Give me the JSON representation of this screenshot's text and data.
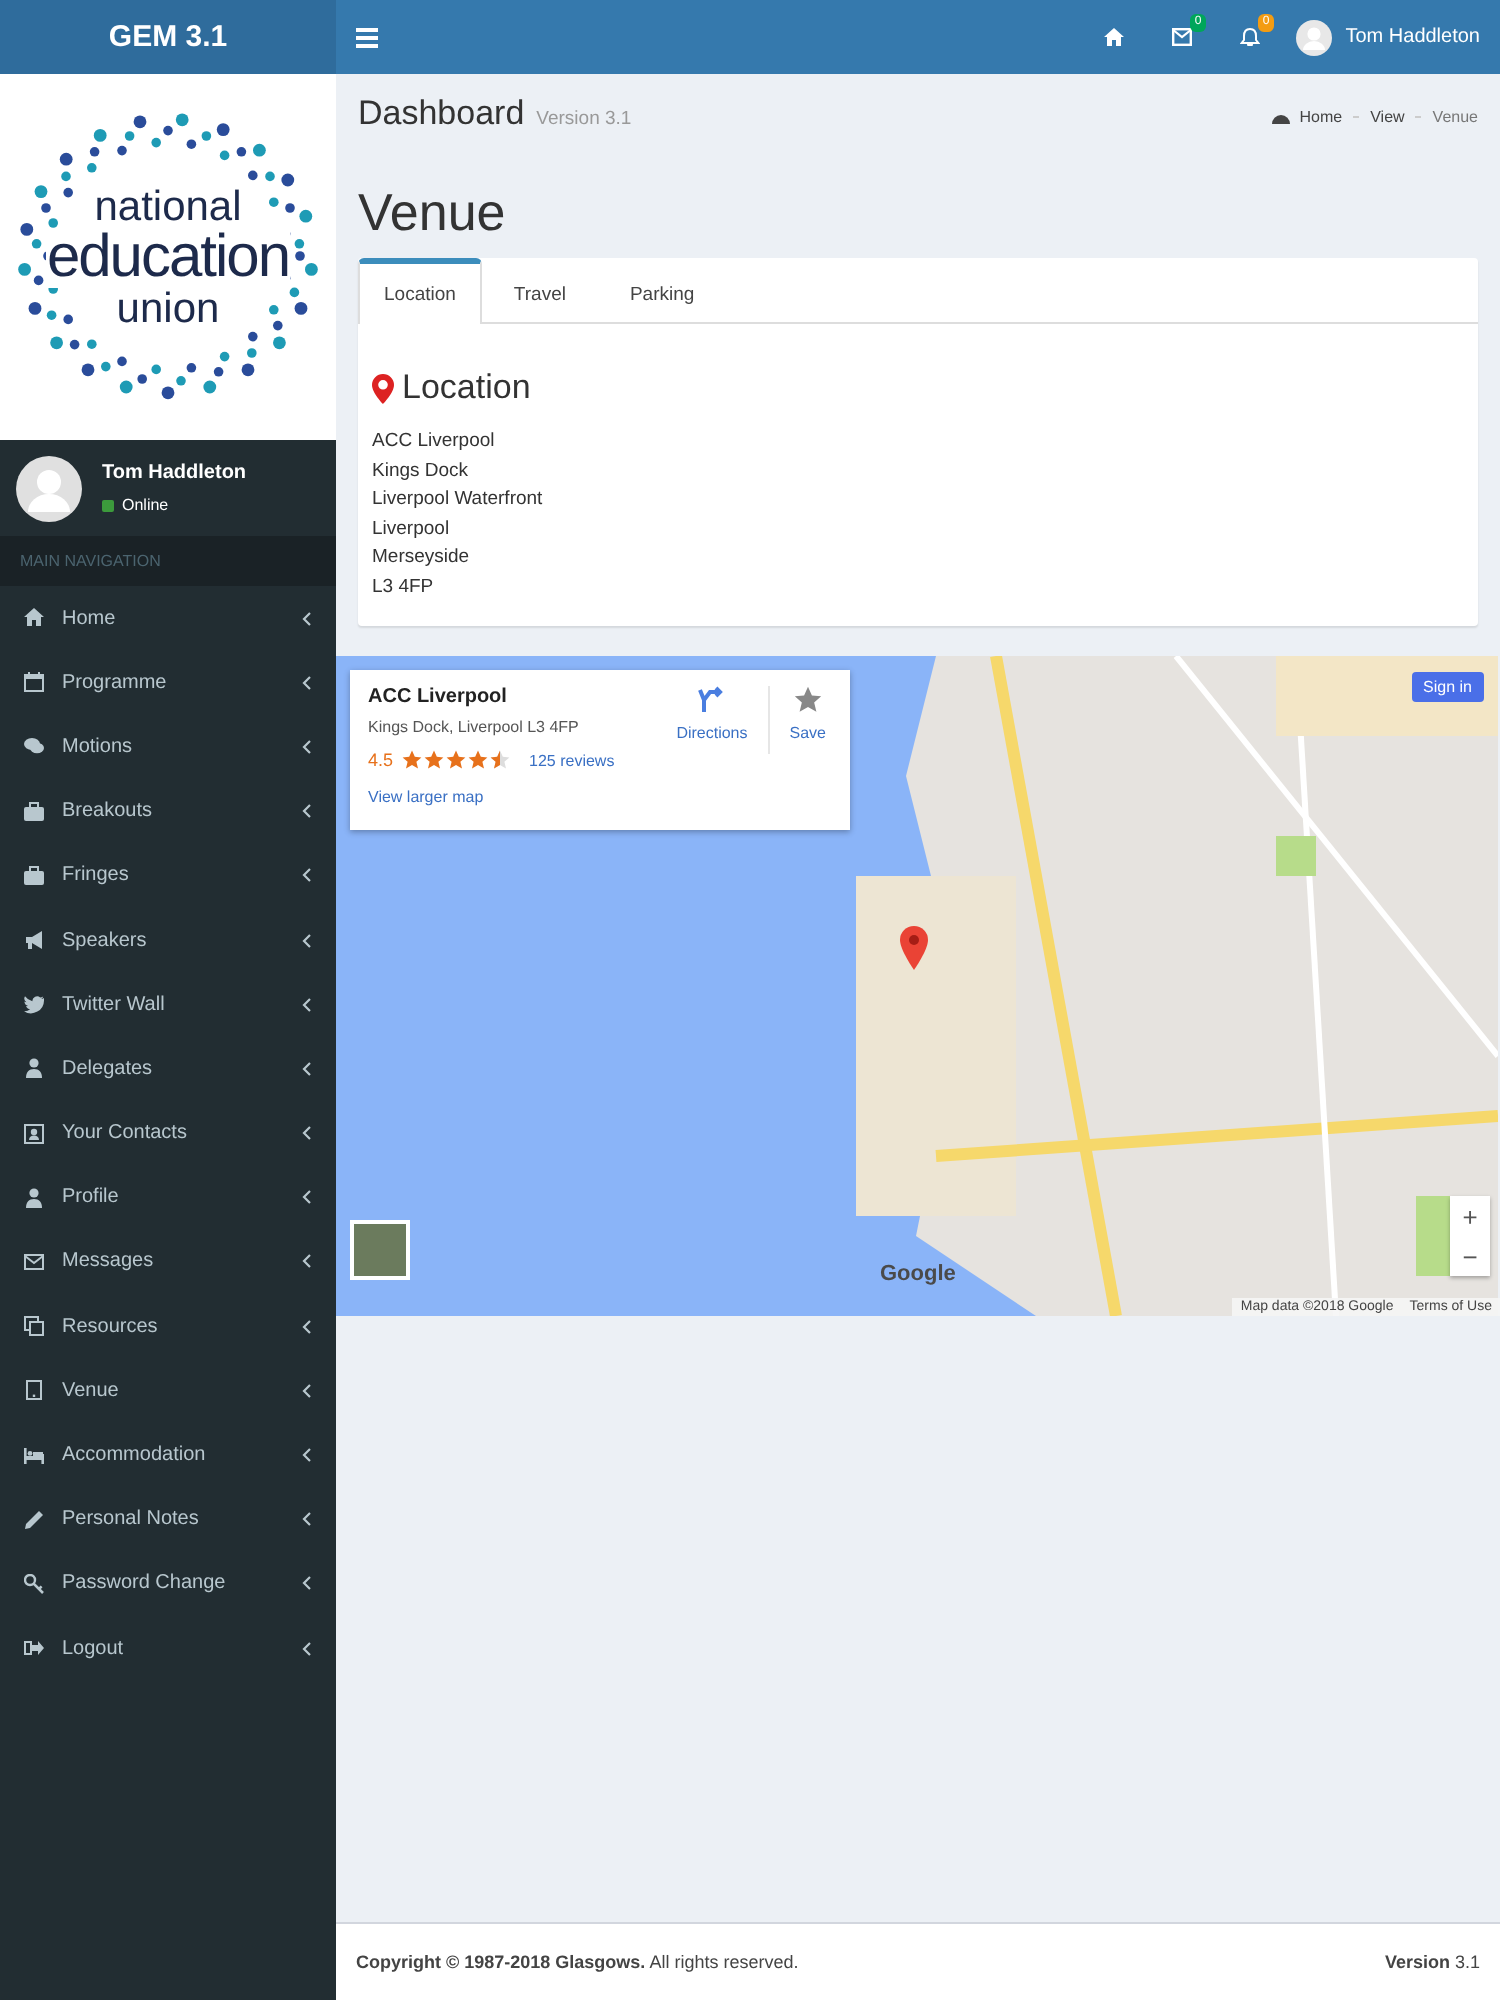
{
  "header": {
    "brand": "GEM 3.1",
    "mail_badge": "0",
    "bell_badge": "0",
    "user": "Tom Haddleton"
  },
  "sidebar": {
    "logo": [
      "national",
      "education",
      "union"
    ],
    "user": {
      "name": "Tom Haddleton",
      "status": "Online"
    },
    "nav_header": "MAIN NAVIGATION",
    "items": [
      {
        "label": "Home"
      },
      {
        "label": "Programme"
      },
      {
        "label": "Motions"
      },
      {
        "label": "Breakouts"
      },
      {
        "label": "Fringes"
      },
      {
        "label": "Speakers"
      },
      {
        "label": "Twitter Wall"
      },
      {
        "label": "Delegates"
      },
      {
        "label": "Your Contacts"
      },
      {
        "label": "Profile"
      },
      {
        "label": "Messages"
      },
      {
        "label": "Resources"
      },
      {
        "label": "Venue"
      },
      {
        "label": "Accommodation"
      },
      {
        "label": "Personal Notes"
      },
      {
        "label": "Password Change"
      },
      {
        "label": "Logout"
      }
    ]
  },
  "page": {
    "title": "Dashboard",
    "subtitle": "Version 3.1",
    "breadcrumb": [
      "Home",
      "View",
      "Venue"
    ]
  },
  "section_title": "Venue",
  "tabs": [
    {
      "label": "Location",
      "selected": true
    },
    {
      "label": "Travel",
      "selected": false
    },
    {
      "label": "Parking",
      "selected": false
    }
  ],
  "location": {
    "heading": "Location",
    "address": [
      "ACC Liverpool",
      "Kings Dock",
      "Liverpool Waterfront",
      "Liverpool",
      "Merseyside",
      "L3 4FP"
    ]
  },
  "map": {
    "card": {
      "name": "ACC Liverpool",
      "address": "Kings Dock, Liverpool L3 4FP",
      "rating": "4.5",
      "stars": 4.5,
      "reviews": "125 reviews",
      "directions": "Directions",
      "save": "Save",
      "larger": "View larger map"
    },
    "sign_in": "Sign in",
    "zoom_in": "+",
    "zoom_out": "−",
    "logo": "Google",
    "attribution": "Map data ©2018 Google",
    "terms": "Terms of Use"
  },
  "footer": {
    "copyright": "**Copyright © 1987-2018 Glasgows.** All rights reserved.",
    "version": "**Version** 3.1"
  }
}
